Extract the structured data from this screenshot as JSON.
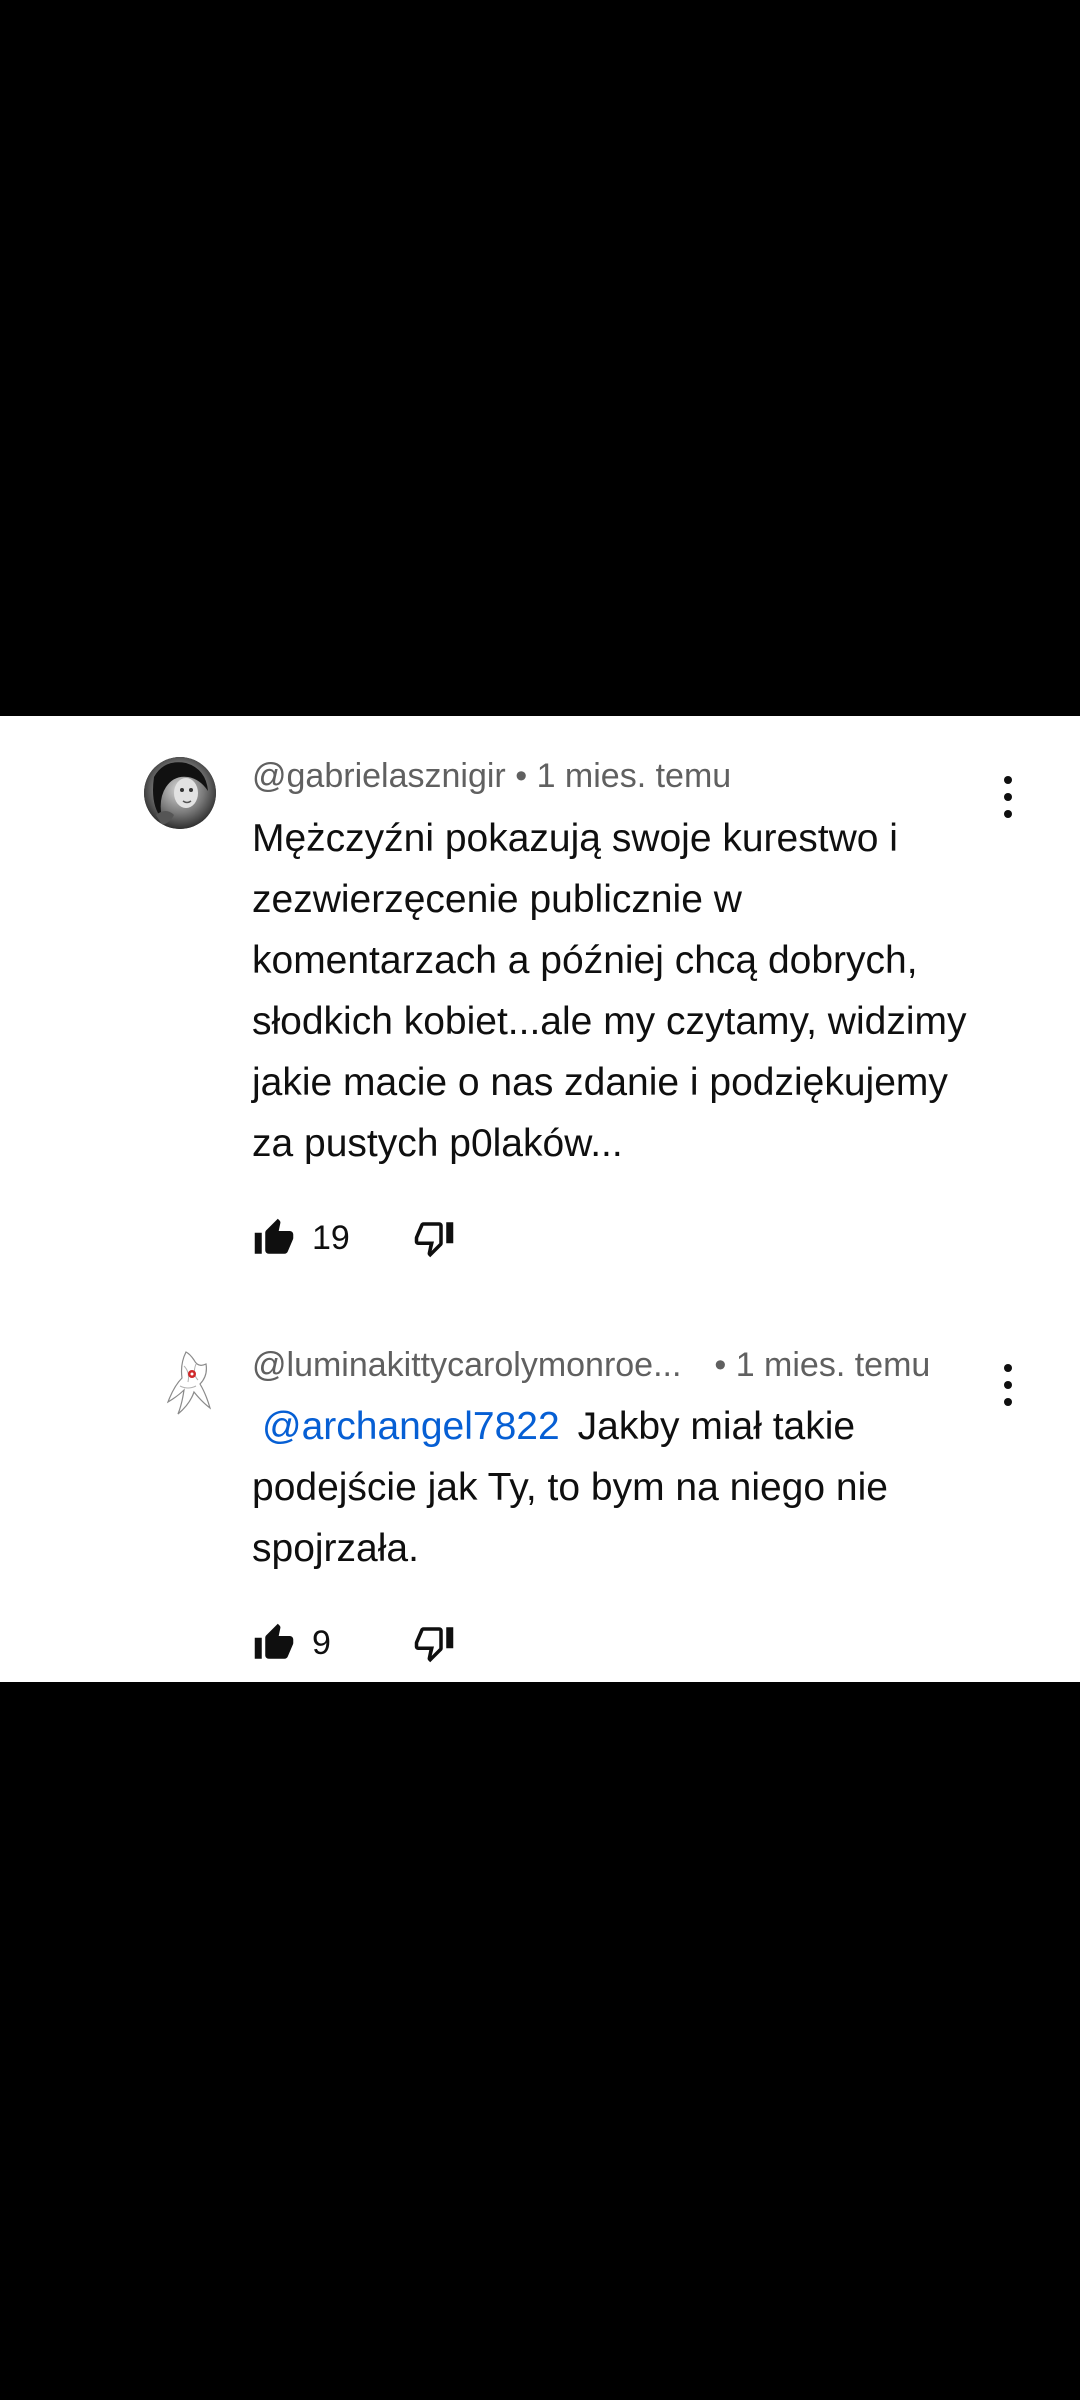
{
  "comments": [
    {
      "author": "@gabrielasznigir",
      "separator": "•",
      "time": "1 mies. temu",
      "text": "Mężczyźni pokazują swoje kurestwo i zezwierzęcenie publicznie w komentarzach a później chcą dobrych, słodkich kobiet...ale my czytamy, widzimy jakie macie o nas zdanie i podziękujemy za pustych p0laków...",
      "likes": "19",
      "avatar_icon": "user-photo-avatar",
      "like_icon": "thumbs-up-filled-icon",
      "dislike_icon": "thumbs-down-outline-icon",
      "menu_icon": "more-vert-icon"
    },
    {
      "author": "@luminakittycarolymonroe...",
      "separator": "•",
      "time": "1 mies. temu",
      "mention": "@archangel7822",
      "text": "Jakby miał takie podejście jak Ty, to bym na niego nie spojrzała.",
      "likes": "9",
      "avatar_icon": "illustration-avatar",
      "like_icon": "thumbs-up-filled-icon",
      "dislike_icon": "thumbs-down-outline-icon",
      "menu_icon": "more-vert-icon"
    }
  ],
  "colors": {
    "background": "#ffffff",
    "letterbox": "#000000",
    "text_primary": "#0f0f0f",
    "text_secondary": "#606060",
    "mention_link": "#065fd4"
  }
}
